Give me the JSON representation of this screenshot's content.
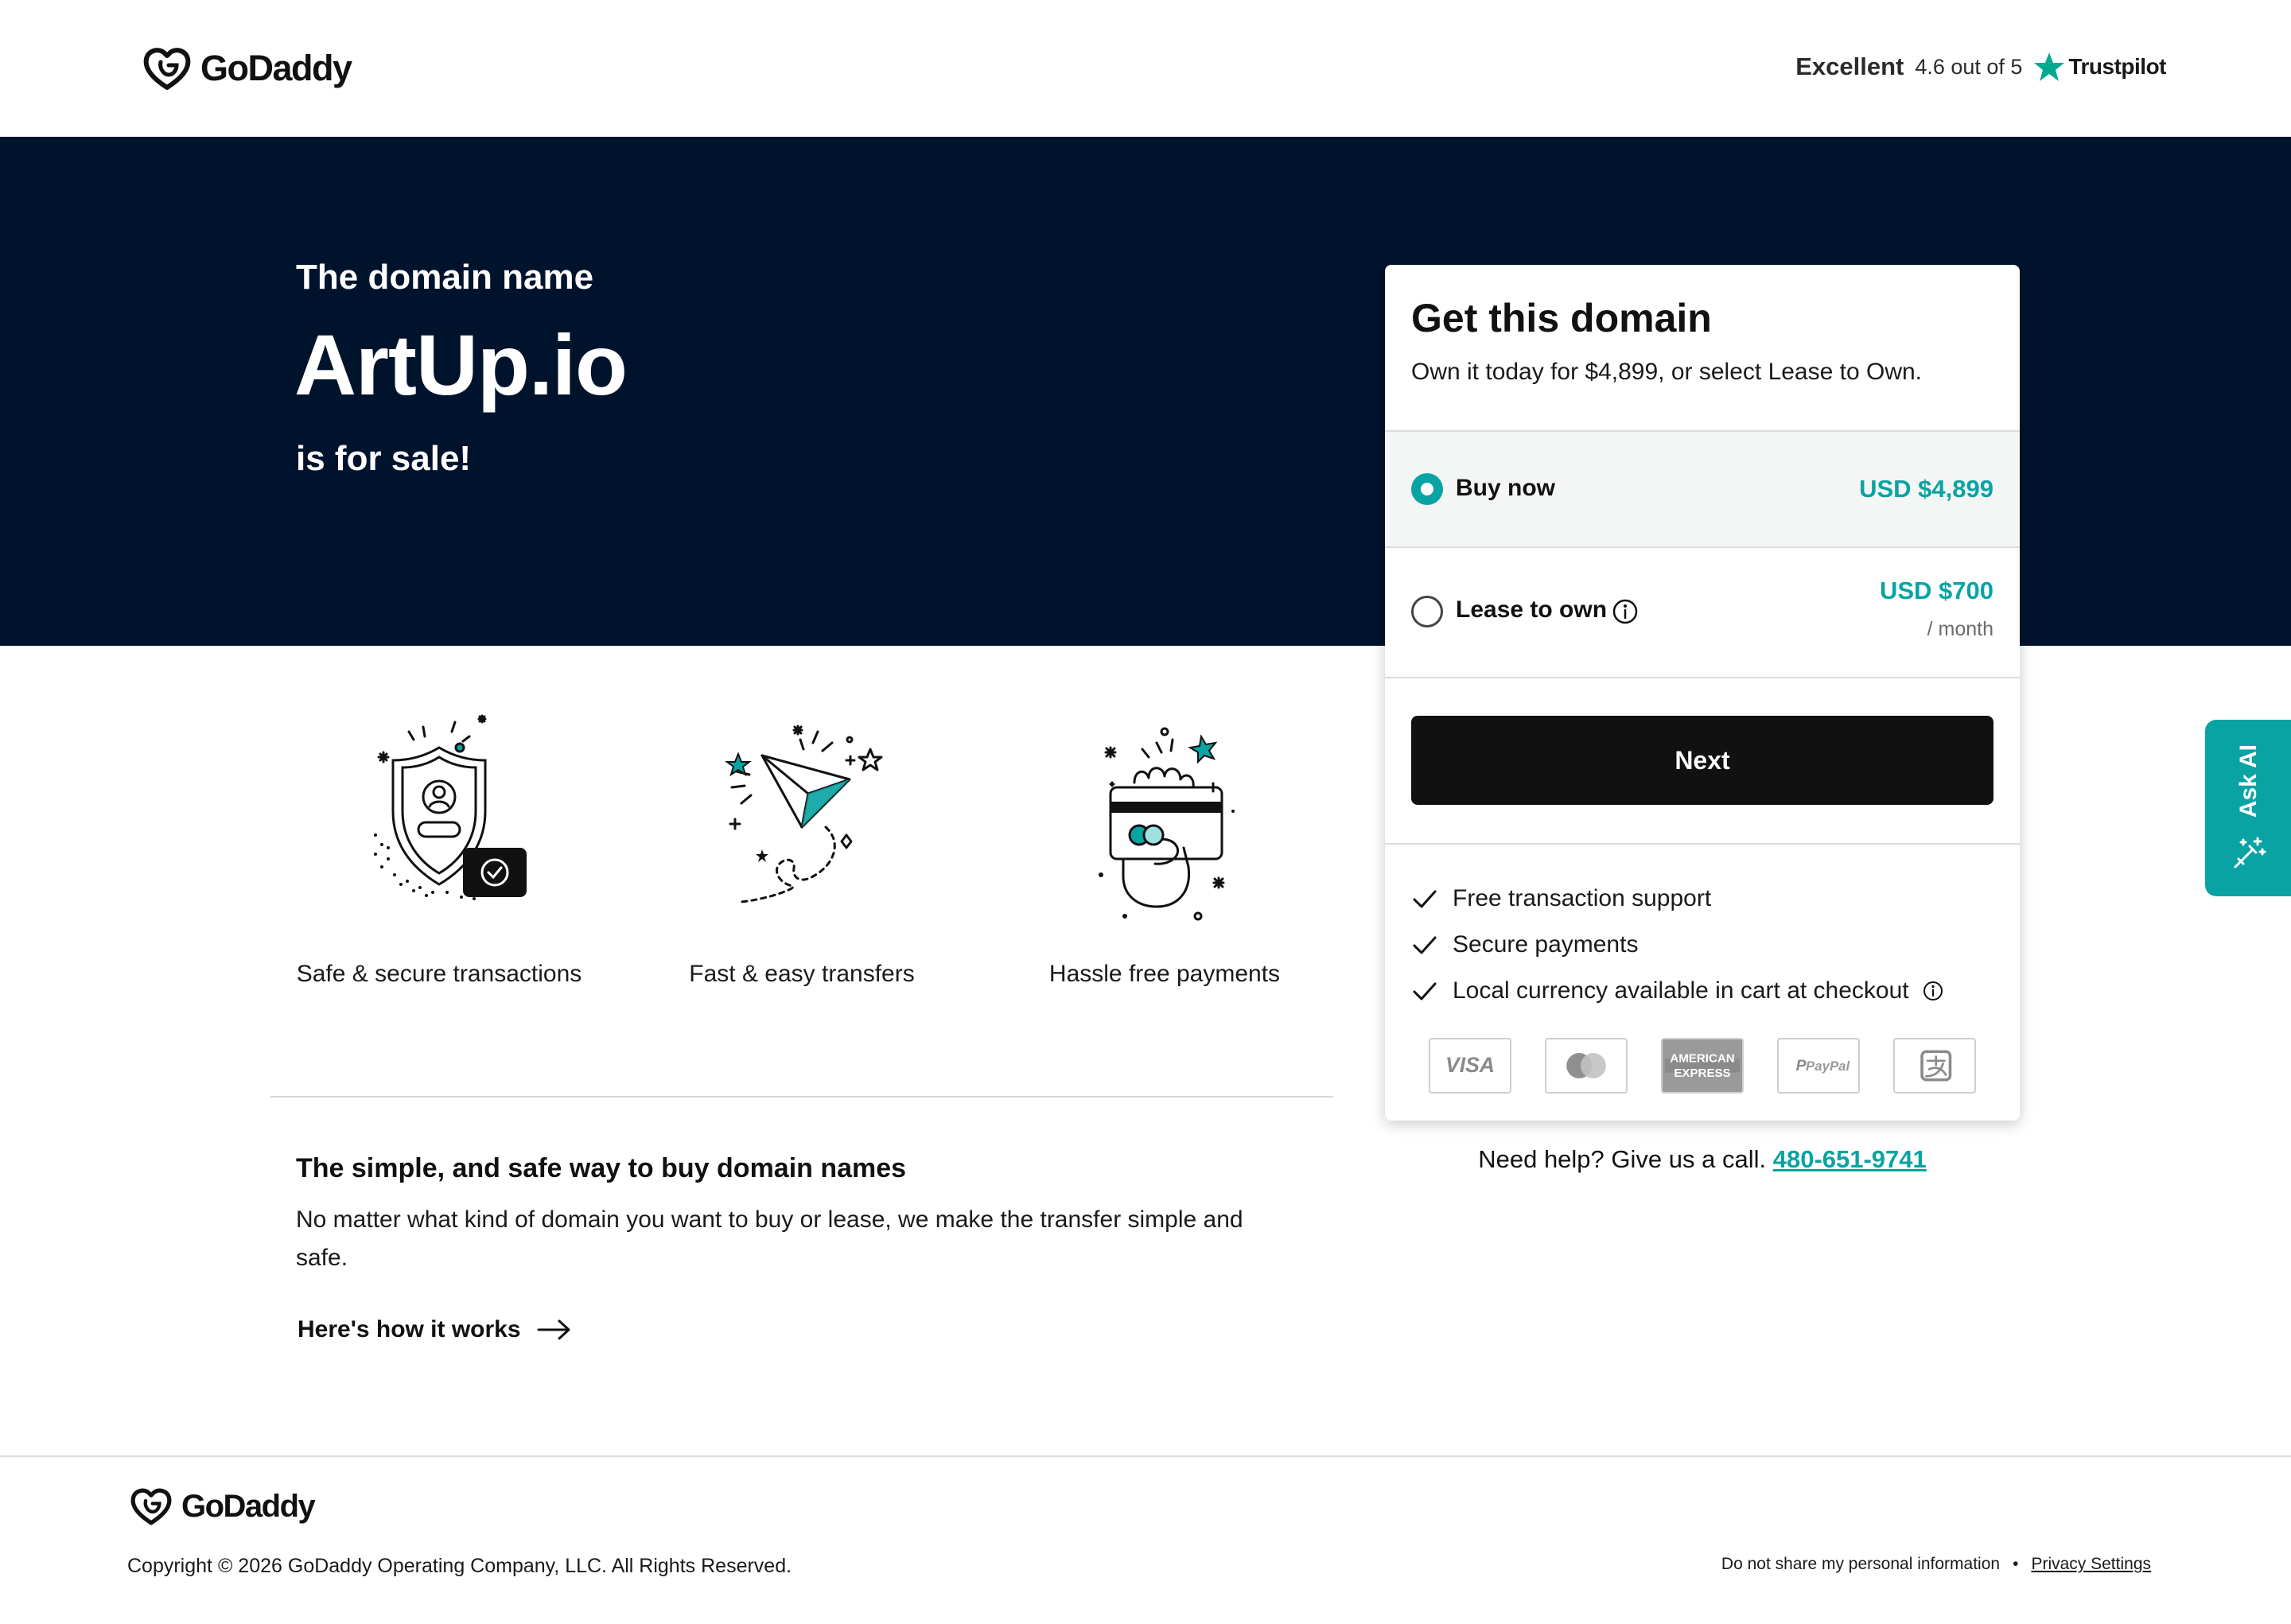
{
  "header": {
    "logo_text": "GoDaddy",
    "trustpilot": {
      "rating_word": "Excellent",
      "score_text": "4.6 out of 5",
      "brand": "Trustpilot"
    }
  },
  "hero": {
    "intro": "The domain name",
    "domain": "ArtUp.io",
    "sale_text": "is for sale!"
  },
  "features": [
    {
      "label": "Safe & secure transactions",
      "icon": "shield-icon"
    },
    {
      "label": "Fast & easy transfers",
      "icon": "paper-plane-icon"
    },
    {
      "label": "Hassle free payments",
      "icon": "credit-card-hand-icon"
    }
  ],
  "info": {
    "title": "The simple, and safe way to buy domain names",
    "body": "No matter what kind of domain you want to buy or lease, we make the transfer simple and safe.",
    "link": "Here's how it works"
  },
  "card": {
    "title": "Get this domain",
    "subtitle": "Own it today for $4,899, or select Lease to Own.",
    "options": [
      {
        "label": "Buy now",
        "price": "USD $4,899",
        "selected": true
      },
      {
        "label": "Lease to own",
        "price": "USD $700",
        "period": "/ month",
        "selected": false
      }
    ],
    "next_label": "Next",
    "benefits": [
      "Free transaction support",
      "Secure payments",
      "Local currency available in cart at checkout"
    ],
    "payment_methods": [
      "visa",
      "mastercard",
      "american-express",
      "paypal",
      "alipay"
    ]
  },
  "help": {
    "text": "Need help? Give us a call.",
    "phone": "480-651-9741"
  },
  "ask_ai": {
    "label": "Ask AI"
  },
  "footer": {
    "logo_text": "GoDaddy",
    "copyright": "Copyright © 2026 GoDaddy Operating Company, LLC. All Rights Reserved.",
    "do_not_share": "Do not share my personal information",
    "bullet": "•",
    "privacy": "Privacy Settings"
  },
  "colors": {
    "hero_bg": "#00132d",
    "accent_teal": "#09a3a3",
    "button_bg": "#111111"
  }
}
